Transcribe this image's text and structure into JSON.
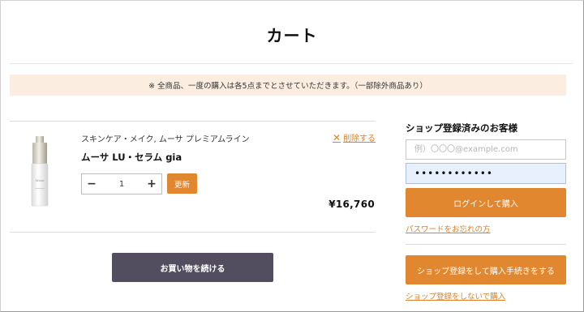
{
  "page": {
    "title": "カート",
    "notice": "※ 全商品、一度の購入は各5点までとさせていただきます。（一部除外商品あり）"
  },
  "cart": {
    "item": {
      "category": "スキンケア・メイク, ムーサ プレミアムライン",
      "name": "ムーサ LU・セラム gia",
      "quantity": "1",
      "price": "¥16,760",
      "image_icon": "serum-bottle-image"
    },
    "delete_label": "削除する",
    "minus_label": "−",
    "plus_label": "+",
    "update_label": "更新",
    "continue_label": "お買い物を続ける"
  },
  "login": {
    "heading": "ショップ登録済みのお客様",
    "email_placeholder": "例）〇〇〇@example.com",
    "password_value": "••••••••••••",
    "login_label": "ログインして購入",
    "forgot_label": "パスワードをお忘れの方",
    "register_label": "ショップ登録をして購入手続きをする",
    "guest_label": "ショップ登録をしないで購入"
  },
  "colors": {
    "accent": "#e0872f",
    "notice_bg": "#fbeee0",
    "continue_bg": "#524e60",
    "password_bg": "#e8f0fe"
  }
}
